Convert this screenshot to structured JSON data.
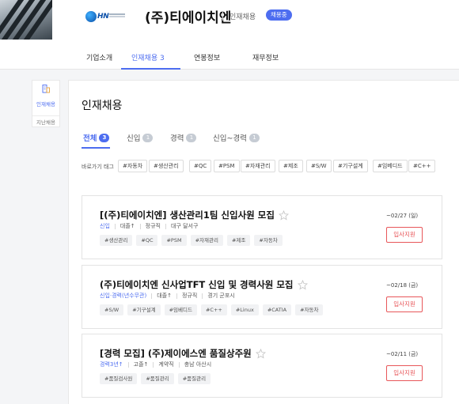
{
  "header": {
    "logo_text": "HN",
    "company_name": "(주)티에이치엔",
    "subtitle": "인재채용",
    "badge": "채용중"
  },
  "nav": {
    "items": [
      "기업소개",
      "인재채용 3",
      "연봉정보",
      "재무정보"
    ],
    "active_index": 1
  },
  "side": {
    "items": [
      "인재채용",
      "지난채용"
    ]
  },
  "main": {
    "title": "인재채용",
    "tabs": [
      {
        "label": "전체",
        "count": "3"
      },
      {
        "label": "신입",
        "count": "1"
      },
      {
        "label": "경력",
        "count": "1"
      },
      {
        "label": "신입~경력",
        "count": "1"
      }
    ],
    "quick_label": "바로가기 태그",
    "quick_tags": [
      "#자동차",
      "#생산관리",
      "#QC",
      "#PSM",
      "#자재관리",
      "#제조",
      "#S/W",
      "#기구설계",
      "#임베디드",
      "#C++"
    ],
    "apply_label": "입사지원"
  },
  "jobs": [
    {
      "title": "[(주)티에이치엔] 생산관리1팀 신입사원 모집",
      "meta": [
        "신입",
        "대졸↑",
        "정규직",
        "대구 달서구"
      ],
      "tags": [
        "#생산관리",
        "#QC",
        "#PSM",
        "#자재관리",
        "#제조",
        "#자동차"
      ],
      "deadline": "~02/27 (일)"
    },
    {
      "title": "(주)티에이치엔 신사업TFT 신입 및 경력사원 모집",
      "meta": [
        "신입·경력(년수무관)",
        "대졸↑",
        "정규직",
        "경기 군포시"
      ],
      "tags": [
        "#S/W",
        "#기구설계",
        "#임베디드",
        "#C++",
        "#Linux",
        "#CATIA",
        "#자동차"
      ],
      "deadline": "~02/18 (금)"
    },
    {
      "title": "[경력 모집] (주)제이에스엔 품질상주원",
      "meta": [
        "경력3년↑",
        "고졸↑",
        "계약직",
        "충남 아산시"
      ],
      "tags": [
        "#품질검사원",
        "#품질관리",
        "#품질관리"
      ],
      "deadline": "~02/11 (금)"
    }
  ],
  "colors": {
    "accent": "#4d6df0",
    "apply": "#e8575a",
    "badge": "#4d6df0"
  },
  "icons": [
    "building-icon",
    "star-icon"
  ]
}
